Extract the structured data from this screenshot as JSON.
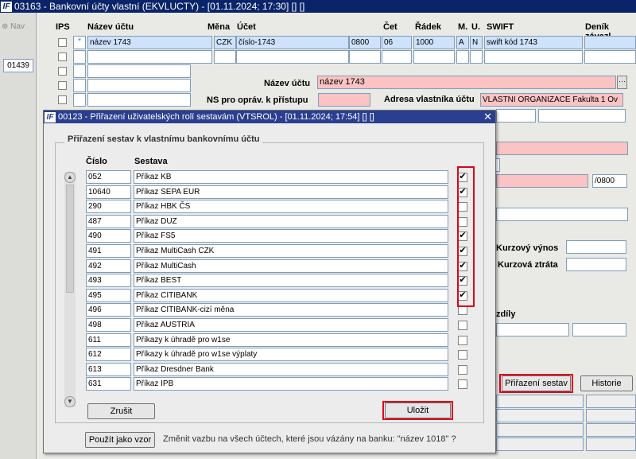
{
  "main_window": {
    "title": "03163 - Bankovní účty vlastní (EKVLUCTY) - [01.11.2024; 17:30] [] []",
    "nav_label": "Nav",
    "left_code": "01439",
    "columns": {
      "ips": "IPS",
      "nazev": "Název účtu",
      "mena": "Měna",
      "ucet": "Účet",
      "cet": "Čet",
      "radek": "Řádek",
      "m": "M.",
      "u": "U.",
      "swift": "SWIFT",
      "denik": "Deník závazl"
    },
    "row": {
      "nazev": "název 1743",
      "mena": "CZK",
      "ucet": "číslo-1743",
      "kod": "0800",
      "cet": "06",
      "radek": "1000",
      "m": "A",
      "u": "N",
      "swift": "swift kód 1743"
    },
    "form": {
      "nazev_label": "Název účtu",
      "nazev_value": "název 1743",
      "ns_label": "NS pro opráv. k přístupu",
      "adresa_label": "Adresa vlastníka účtu",
      "adresa_value": "VLASTNI ORGANIZACE Fakulta 1 Ov",
      "bank_code": "/0800",
      "kurz_vynos": "Kurzový výnos",
      "kurz_ztrata": "Kurzová ztráta",
      "rozdily": "zdíly",
      "prirazeni_btn": "Přiřazení sestav",
      "historie_btn": "Historie"
    }
  },
  "dialog": {
    "title": "00123 - Přiřazení uživatelských rolí sestavám (VTSROL) - [01.11.2024; 17:54] [] []",
    "group_title": "Přiřazení sestav k vlastnímu bankovnímu účtu",
    "col_cislo": "Číslo",
    "col_sestava": "Sestava",
    "rows": [
      {
        "cislo": "052",
        "sestava": "Příkaz KB",
        "checked": true
      },
      {
        "cislo": "10640",
        "sestava": "Příkaz SEPA EUR",
        "checked": true
      },
      {
        "cislo": "290",
        "sestava": "Příkaz HBK ČS",
        "checked": false
      },
      {
        "cislo": "487",
        "sestava": "Příkaz DUZ",
        "checked": false
      },
      {
        "cislo": "490",
        "sestava": "Příkaz FS5",
        "checked": true
      },
      {
        "cislo": "491",
        "sestava": "Příkaz MultiCash CZK",
        "checked": true
      },
      {
        "cislo": "492",
        "sestava": "Příkaz MultiCash",
        "checked": true
      },
      {
        "cislo": "493",
        "sestava": "Příkaz BEST",
        "checked": true
      },
      {
        "cislo": "495",
        "sestava": "Příkaz CITIBANK",
        "checked": true
      },
      {
        "cislo": "496",
        "sestava": "Příkaz CITIBANK-cizí měna",
        "checked": false
      },
      {
        "cislo": "498",
        "sestava": "Příkaz AUSTRIA",
        "checked": false
      },
      {
        "cislo": "611",
        "sestava": "Příkazy k úhradě pro w1se",
        "checked": false
      },
      {
        "cislo": "612",
        "sestava": "Příkazy k úhradě pro w1se výplaty",
        "checked": false
      },
      {
        "cislo": "613",
        "sestava": "Příkaz Dresdner Bank",
        "checked": false
      },
      {
        "cislo": "631",
        "sestava": "Příkaz IPB",
        "checked": false
      }
    ],
    "zrusit_btn": "Zrušit",
    "ulozit_btn": "Uložit",
    "pouzit_btn": "Použít jako vzor",
    "pouzit_text": "Změnit vazbu na všech účtech, které jsou vázány na banku: \"název 1018\" ?"
  },
  "colors": {
    "title_bg": "#0a246a",
    "dialog_title_bg": "#2a3f8f",
    "highlight": "#e0001b",
    "pink": "#fbc3c3"
  }
}
